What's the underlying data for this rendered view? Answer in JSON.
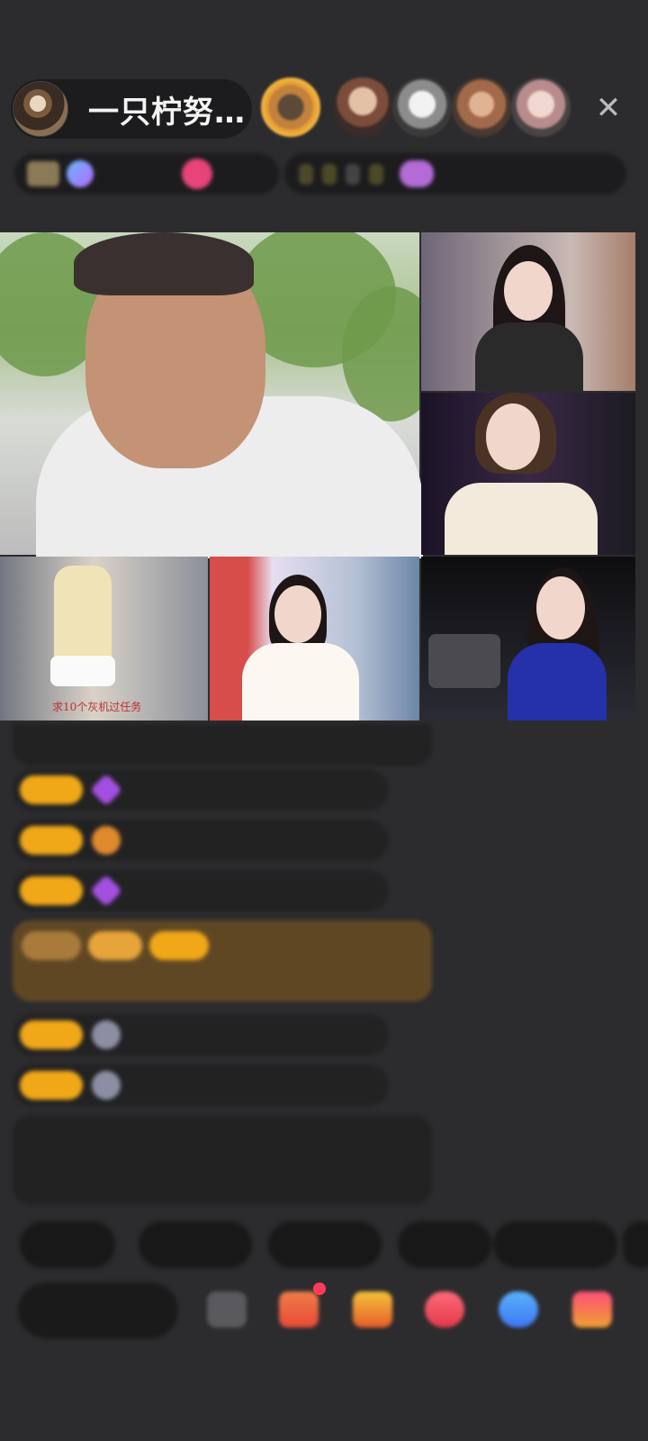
{
  "header": {
    "host_name": "一只柠努…",
    "close_icon": "close-icon",
    "viewers": [
      "viewer-1",
      "viewer-2",
      "viewer-3",
      "viewer-4",
      "viewer-5"
    ]
  },
  "info": {
    "left_icons": [
      "level-badge-icon",
      "fan-club-icon",
      "follow-icon"
    ],
    "right_icons": [
      "rank-icon"
    ]
  },
  "video": {
    "tile4_label": "求10个灰机过任务"
  },
  "chat": {
    "icons": [
      "level-badge",
      "gem-icon",
      "fan-badge-icon"
    ]
  },
  "quick_replies": [],
  "bottom": {
    "icons": [
      "emoji-icon",
      "gift-box-icon",
      "gift-icon",
      "game-icon",
      "chat-bubble-icon",
      "more-icon"
    ]
  },
  "colors": {
    "background": "#2c2c2e",
    "badge": "#f0a818",
    "viewer_highlight": "#f0b33e",
    "notification": "#ff3b5c"
  }
}
